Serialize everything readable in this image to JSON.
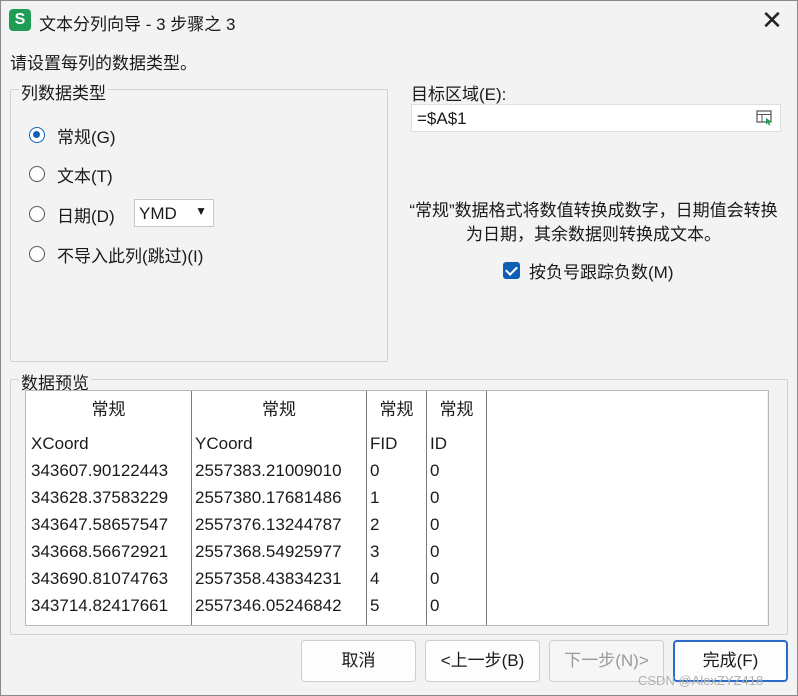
{
  "window": {
    "title": "文本分列向导 - 3 步骤之 3",
    "app_icon": "S"
  },
  "instruction": "请设置每列的数据类型。",
  "column_type_group": {
    "legend": "列数据类型",
    "options": [
      {
        "label": "常规(G)",
        "checked": true
      },
      {
        "label": "文本(T)",
        "checked": false
      },
      {
        "label": "日期(D)",
        "checked": false
      },
      {
        "label": "不导入此列(跳过)(I)",
        "checked": false
      }
    ],
    "date_format": "YMD"
  },
  "destination": {
    "label": "目标区域(E):",
    "value": "=$A$1"
  },
  "description": "“常规”数据格式将数值转换成数字，日期值会转换为日期，其余数据则转换成文本。",
  "negative_checkbox": {
    "label": "按负号跟踪负数(M)",
    "checked": true
  },
  "preview": {
    "legend": "数据预览",
    "headers": [
      "常规",
      "常规",
      "常规",
      "常规"
    ],
    "rows": [
      [
        "XCoord",
        "YCoord",
        "FID",
        "ID"
      ],
      [
        "343607.90122443",
        "2557383.21009010",
        "0",
        "0"
      ],
      [
        "343628.37583229",
        "2557380.17681486",
        "1",
        "0"
      ],
      [
        "343647.58657547",
        "2557376.13244787",
        "2",
        "0"
      ],
      [
        "343668.56672921",
        "2557368.54925977",
        "3",
        "0"
      ],
      [
        "343690.81074763",
        "2557358.43834231",
        "4",
        "0"
      ],
      [
        "343714.82417661",
        "2557346.05246842",
        "5",
        "0"
      ]
    ]
  },
  "buttons": {
    "cancel": "取消",
    "back": "<上一步(B)",
    "next": "下一步(N)>",
    "finish": "完成(F)"
  },
  "watermark": "CSDN @AlexZYZ418"
}
